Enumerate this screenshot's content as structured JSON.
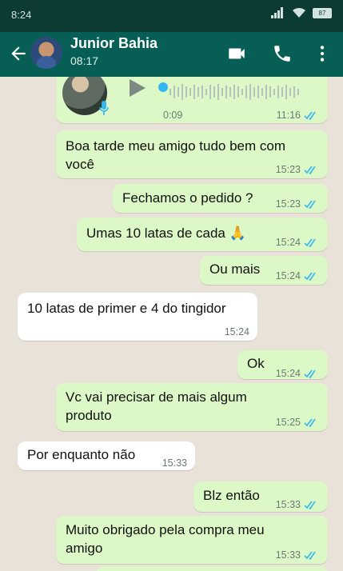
{
  "status": {
    "time": "8:24",
    "battery": "87"
  },
  "header": {
    "contact_name": "Junior Bahia",
    "subtitle": "08:17"
  },
  "messages": [
    {
      "type": "audio",
      "dir": "out",
      "duration": "0:09",
      "time": "11:16",
      "status": "read"
    },
    {
      "type": "text",
      "dir": "out",
      "text": "Boa tarde meu amigo tudo bem com você",
      "time": "15:23",
      "status": "read"
    },
    {
      "type": "text",
      "dir": "out",
      "text": "Fechamos o pedido ?",
      "time": "15:23",
      "status": "read"
    },
    {
      "type": "text",
      "dir": "out",
      "text": "Umas 10 latas de cada 🙏",
      "time": "15:24",
      "status": "read"
    },
    {
      "type": "text",
      "dir": "out",
      "text": "Ou mais",
      "time": "15:24",
      "status": "read"
    },
    {
      "type": "text",
      "dir": "in",
      "text": "10 latas de primer e 4 do tingidor",
      "time": "15:24"
    },
    {
      "type": "text",
      "dir": "out",
      "text": "Ok",
      "time": "15:24",
      "status": "read"
    },
    {
      "type": "text",
      "dir": "out",
      "text": "Vc vai precisar de mais algum produto",
      "time": "15:25",
      "status": "read"
    },
    {
      "type": "text",
      "dir": "in",
      "text": "Por enquanto não",
      "time": "15:33"
    },
    {
      "type": "text",
      "dir": "out",
      "text": "Blz então",
      "time": "15:33",
      "status": "read"
    },
    {
      "type": "text",
      "dir": "out",
      "text": "Muito obrigado pela compra meu amigo",
      "time": "15:33",
      "status": "read"
    }
  ],
  "colors": {
    "header": "#075e54",
    "statusbar": "#0b3b33",
    "outgoing": "#dcf8c6",
    "incoming": "#ffffff",
    "read_ticks": "#34b7f1"
  }
}
